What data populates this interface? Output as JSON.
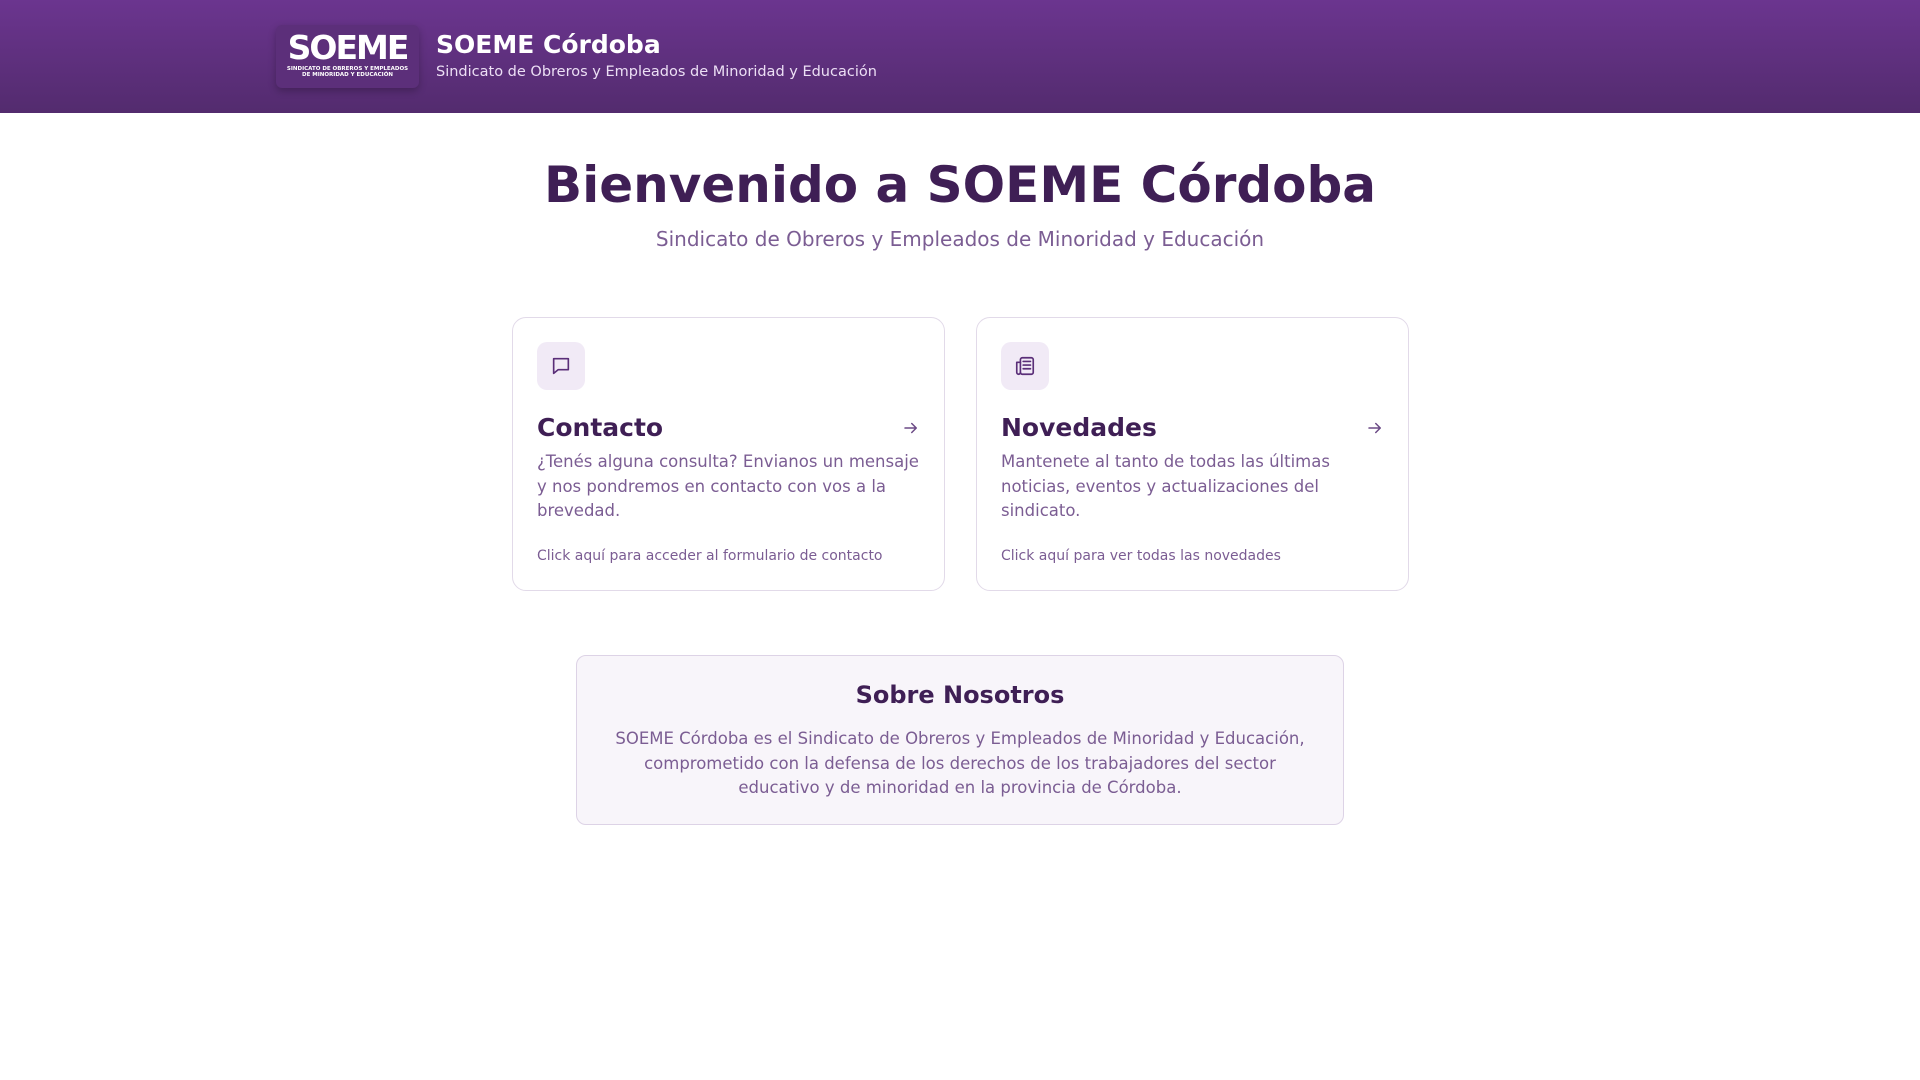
{
  "header": {
    "logo": {
      "wordmark": "SOEME",
      "tagline": "SINDICATO DE OBREROS Y EMPLEADOS DE MINORIDAD Y EDUCACIÓN"
    },
    "title": "SOEME Córdoba",
    "subtitle": "Sindicato de Obreros y Empleados de Minoridad y Educación"
  },
  "hero": {
    "title": "Bienvenido a SOEME Córdoba",
    "subtitle": "Sindicato de Obreros y Empleados de Minoridad y Educación"
  },
  "cards": [
    {
      "icon": "chat-icon",
      "title": "Contacto",
      "description": "¿Tenés alguna consulta? Envianos un mensaje y nos pondremos en contacto con vos a la brevedad.",
      "link": "Click aquí para acceder al formulario de contacto"
    },
    {
      "icon": "newspaper-icon",
      "title": "Novedades",
      "description": "Mantenete al tanto de todas las últimas noticias, eventos y actualizaciones del sindicato.",
      "link": "Click aquí para ver todas las novedades"
    }
  ],
  "about": {
    "title": "Sobre Nosotros",
    "text": "SOEME Córdoba es el Sindicato de Obreros y Empleados de Minoridad y Educación, comprometido con la defensa de los derechos de los trabajadores del sector educativo y de minoridad en la provincia de Córdoba."
  },
  "colors": {
    "header_top": "#6b358f",
    "header_bottom": "#532b6e",
    "heading": "#3f1f55",
    "muted_text": "#7b5d93",
    "icon_bg": "#f1eaf6"
  }
}
